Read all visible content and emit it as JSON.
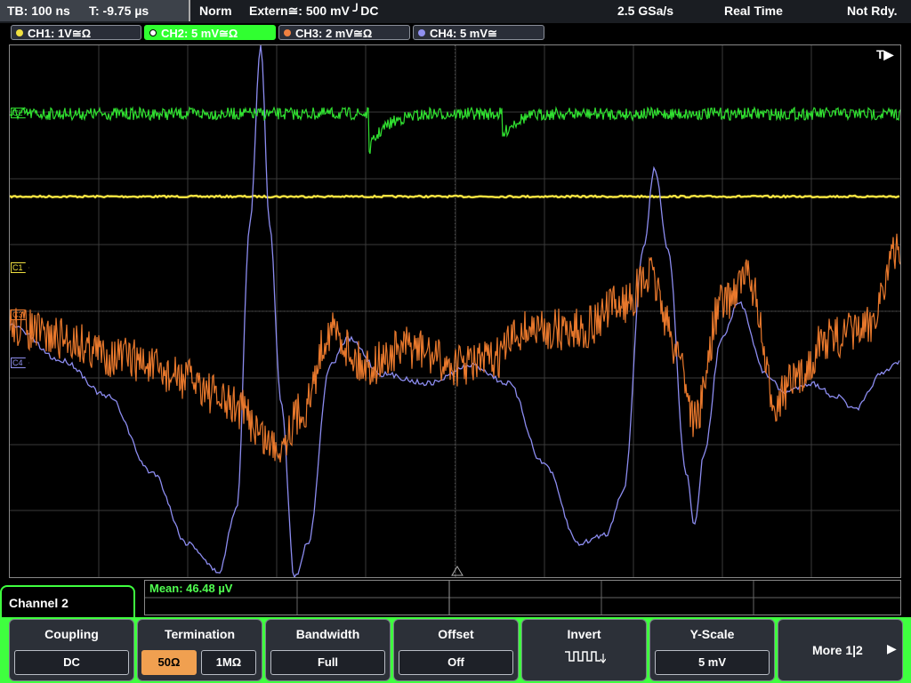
{
  "status": {
    "timebase": "TB: 100 ns",
    "trigger_time": "T: -9.75 µs",
    "mode": "Norm",
    "trigger_source": "Extern≅: 500 mV ╯DC",
    "sample_rate": "2.5 GSa/s",
    "acq_mode": "Real Time",
    "ready": "Not Rdy."
  },
  "channels": [
    {
      "label": "CH1: 1V≅Ω",
      "color": "#f0e040"
    },
    {
      "label": "CH2: 5 mV≅Ω",
      "color": "#40ff40",
      "active": true
    },
    {
      "label": "CH3: 2 mV≅Ω",
      "color": "#f08040"
    },
    {
      "label": "CH4: 5 mV≅",
      "color": "#9090f0"
    }
  ],
  "markers": {
    "trigger": "T▶",
    "ch1": "C1",
    "ch2": "C2",
    "ch3": "C3",
    "ch4": "C4"
  },
  "measurement": "Mean: 46.48 µV",
  "menu_title": "Channel 2",
  "softkeys": {
    "coupling": {
      "title": "Coupling",
      "value": "DC"
    },
    "termination": {
      "title": "Termination",
      "options": [
        "50Ω",
        "1MΩ"
      ],
      "selected": 0
    },
    "bandwidth": {
      "title": "Bandwidth",
      "value": "Full"
    },
    "offset": {
      "title": "Offset",
      "value": "Off"
    },
    "invert": {
      "title": "Invert",
      "icon": "invert-waveform-icon"
    },
    "yscale": {
      "title": "Y-Scale",
      "value": "5 mV"
    },
    "more": {
      "label": "More 1|2"
    }
  }
}
